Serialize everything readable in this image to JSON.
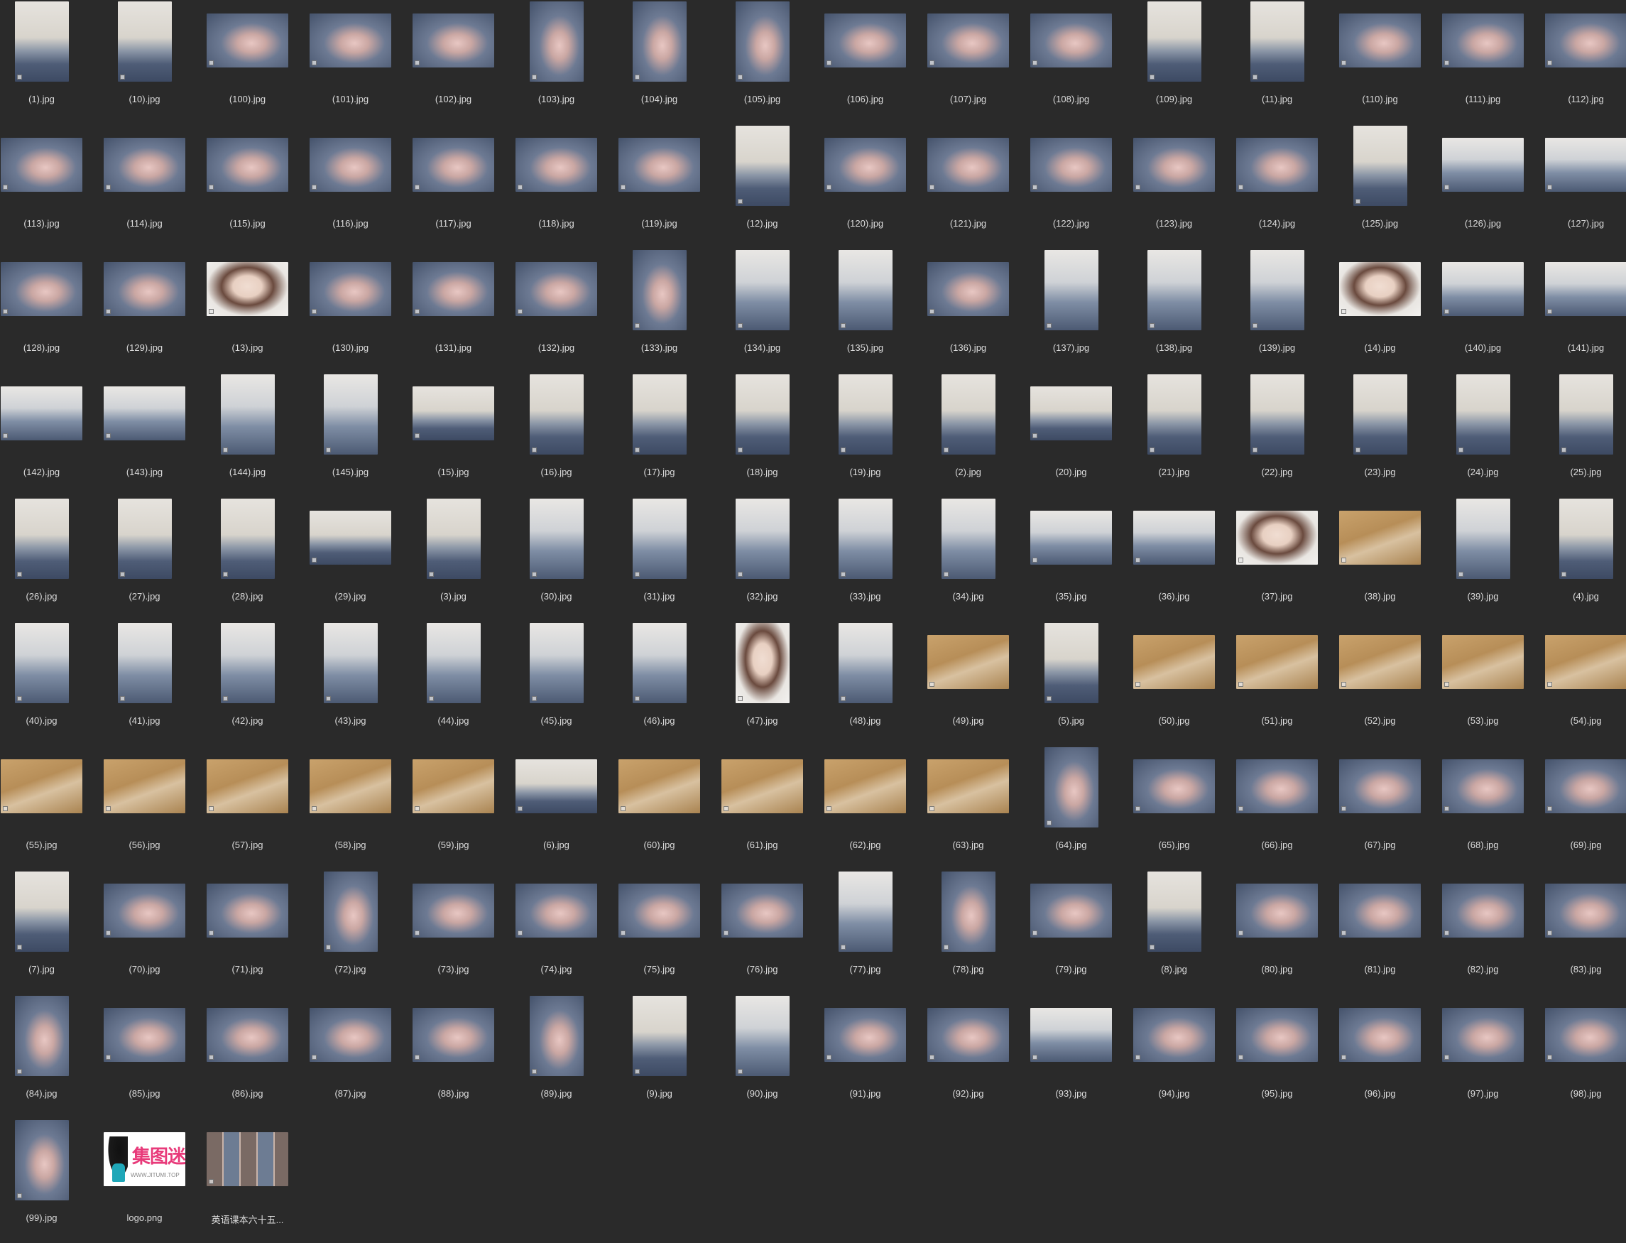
{
  "window": {
    "background": "#2a2a2a"
  },
  "logo": {
    "text": "集图迷",
    "url": "WWW.JITUMI.TOP"
  },
  "files": [
    {
      "name": "(1).jpg",
      "kind": "portrait",
      "style": "room"
    },
    {
      "name": "(10).jpg",
      "kind": "portrait",
      "style": "room"
    },
    {
      "name": "(100).jpg",
      "kind": "land",
      "style": "bed"
    },
    {
      "name": "(101).jpg",
      "kind": "land",
      "style": "bed"
    },
    {
      "name": "(102).jpg",
      "kind": "land",
      "style": "bed"
    },
    {
      "name": "(103).jpg",
      "kind": "portrait",
      "style": "bed"
    },
    {
      "name": "(104).jpg",
      "kind": "portrait",
      "style": "bed"
    },
    {
      "name": "(105).jpg",
      "kind": "portrait",
      "style": "bed"
    },
    {
      "name": "(106).jpg",
      "kind": "land",
      "style": "bed"
    },
    {
      "name": "(107).jpg",
      "kind": "land",
      "style": "bed"
    },
    {
      "name": "(108).jpg",
      "kind": "land",
      "style": "bed"
    },
    {
      "name": "(109).jpg",
      "kind": "portrait",
      "style": "room"
    },
    {
      "name": "(11).jpg",
      "kind": "portrait",
      "style": "room"
    },
    {
      "name": "(110).jpg",
      "kind": "land",
      "style": "bed"
    },
    {
      "name": "(111).jpg",
      "kind": "land",
      "style": "bed"
    },
    {
      "name": "(112).jpg",
      "kind": "land",
      "style": "bed"
    },
    {
      "name": "(113).jpg",
      "kind": "land",
      "style": "bed"
    },
    {
      "name": "(114).jpg",
      "kind": "land",
      "style": "bed"
    },
    {
      "name": "(115).jpg",
      "kind": "land",
      "style": "bed"
    },
    {
      "name": "(116).jpg",
      "kind": "land",
      "style": "bed"
    },
    {
      "name": "(117).jpg",
      "kind": "land",
      "style": "bed"
    },
    {
      "name": "(118).jpg",
      "kind": "land",
      "style": "bed"
    },
    {
      "name": "(119).jpg",
      "kind": "land",
      "style": "bed"
    },
    {
      "name": "(12).jpg",
      "kind": "portrait",
      "style": "room"
    },
    {
      "name": "(120).jpg",
      "kind": "land",
      "style": "bed"
    },
    {
      "name": "(121).jpg",
      "kind": "land",
      "style": "bed"
    },
    {
      "name": "(122).jpg",
      "kind": "land",
      "style": "bed"
    },
    {
      "name": "(123).jpg",
      "kind": "land",
      "style": "bed"
    },
    {
      "name": "(124).jpg",
      "kind": "land",
      "style": "bed"
    },
    {
      "name": "(125).jpg",
      "kind": "portrait",
      "style": "room"
    },
    {
      "name": "(126).jpg",
      "kind": "land",
      "style": "sofa"
    },
    {
      "name": "(127).jpg",
      "kind": "land",
      "style": "sofa"
    },
    {
      "name": "(128).jpg",
      "kind": "land",
      "style": "bed"
    },
    {
      "name": "(129).jpg",
      "kind": "land",
      "style": "bed"
    },
    {
      "name": "(13).jpg",
      "kind": "land",
      "style": "face"
    },
    {
      "name": "(130).jpg",
      "kind": "land",
      "style": "bed"
    },
    {
      "name": "(131).jpg",
      "kind": "land",
      "style": "bed"
    },
    {
      "name": "(132).jpg",
      "kind": "land",
      "style": "bed"
    },
    {
      "name": "(133).jpg",
      "kind": "portrait",
      "style": "bed"
    },
    {
      "name": "(134).jpg",
      "kind": "portrait",
      "style": "sofa"
    },
    {
      "name": "(135).jpg",
      "kind": "portrait",
      "style": "sofa"
    },
    {
      "name": "(136).jpg",
      "kind": "land",
      "style": "bed"
    },
    {
      "name": "(137).jpg",
      "kind": "portrait",
      "style": "sofa"
    },
    {
      "name": "(138).jpg",
      "kind": "portrait",
      "style": "sofa"
    },
    {
      "name": "(139).jpg",
      "kind": "portrait",
      "style": "sofa"
    },
    {
      "name": "(14).jpg",
      "kind": "land",
      "style": "face"
    },
    {
      "name": "(140).jpg",
      "kind": "land",
      "style": "sofa"
    },
    {
      "name": "(141).jpg",
      "kind": "land",
      "style": "sofa"
    },
    {
      "name": "(142).jpg",
      "kind": "land",
      "style": "sofa"
    },
    {
      "name": "(143).jpg",
      "kind": "land",
      "style": "sofa"
    },
    {
      "name": "(144).jpg",
      "kind": "portrait",
      "style": "sofa"
    },
    {
      "name": "(145).jpg",
      "kind": "portrait",
      "style": "sofa"
    },
    {
      "name": "(15).jpg",
      "kind": "land",
      "style": "room"
    },
    {
      "name": "(16).jpg",
      "kind": "portrait",
      "style": "room"
    },
    {
      "name": "(17).jpg",
      "kind": "portrait",
      "style": "room"
    },
    {
      "name": "(18).jpg",
      "kind": "portrait",
      "style": "room"
    },
    {
      "name": "(19).jpg",
      "kind": "portrait",
      "style": "room"
    },
    {
      "name": "(2).jpg",
      "kind": "portrait",
      "style": "room"
    },
    {
      "name": "(20).jpg",
      "kind": "land",
      "style": "room"
    },
    {
      "name": "(21).jpg",
      "kind": "portrait",
      "style": "room"
    },
    {
      "name": "(22).jpg",
      "kind": "portrait",
      "style": "room"
    },
    {
      "name": "(23).jpg",
      "kind": "portrait",
      "style": "room"
    },
    {
      "name": "(24).jpg",
      "kind": "portrait",
      "style": "room"
    },
    {
      "name": "(25).jpg",
      "kind": "portrait",
      "style": "room"
    },
    {
      "name": "(26).jpg",
      "kind": "portrait",
      "style": "room"
    },
    {
      "name": "(27).jpg",
      "kind": "portrait",
      "style": "room"
    },
    {
      "name": "(28).jpg",
      "kind": "portrait",
      "style": "room"
    },
    {
      "name": "(29).jpg",
      "kind": "land",
      "style": "room"
    },
    {
      "name": "(3).jpg",
      "kind": "portrait",
      "style": "room"
    },
    {
      "name": "(30).jpg",
      "kind": "portrait",
      "style": "sofa"
    },
    {
      "name": "(31).jpg",
      "kind": "portrait",
      "style": "sofa"
    },
    {
      "name": "(32).jpg",
      "kind": "portrait",
      "style": "sofa"
    },
    {
      "name": "(33).jpg",
      "kind": "portrait",
      "style": "sofa"
    },
    {
      "name": "(34).jpg",
      "kind": "portrait",
      "style": "sofa"
    },
    {
      "name": "(35).jpg",
      "kind": "land",
      "style": "sofa"
    },
    {
      "name": "(36).jpg",
      "kind": "land",
      "style": "sofa"
    },
    {
      "name": "(37).jpg",
      "kind": "land",
      "style": "face"
    },
    {
      "name": "(38).jpg",
      "kind": "land",
      "style": "floor"
    },
    {
      "name": "(39).jpg",
      "kind": "portrait",
      "style": "sofa"
    },
    {
      "name": "(4).jpg",
      "kind": "portrait",
      "style": "room"
    },
    {
      "name": "(40).jpg",
      "kind": "portrait",
      "style": "sofa"
    },
    {
      "name": "(41).jpg",
      "kind": "portrait",
      "style": "sofa"
    },
    {
      "name": "(42).jpg",
      "kind": "portrait",
      "style": "sofa"
    },
    {
      "name": "(43).jpg",
      "kind": "portrait",
      "style": "sofa"
    },
    {
      "name": "(44).jpg",
      "kind": "portrait",
      "style": "sofa"
    },
    {
      "name": "(45).jpg",
      "kind": "portrait",
      "style": "sofa"
    },
    {
      "name": "(46).jpg",
      "kind": "portrait",
      "style": "sofa"
    },
    {
      "name": "(47).jpg",
      "kind": "portrait",
      "style": "face"
    },
    {
      "name": "(48).jpg",
      "kind": "portrait",
      "style": "sofa"
    },
    {
      "name": "(49).jpg",
      "kind": "land",
      "style": "floor"
    },
    {
      "name": "(5).jpg",
      "kind": "portrait",
      "style": "room"
    },
    {
      "name": "(50).jpg",
      "kind": "land",
      "style": "floor"
    },
    {
      "name": "(51).jpg",
      "kind": "land",
      "style": "floor"
    },
    {
      "name": "(52).jpg",
      "kind": "land",
      "style": "floor"
    },
    {
      "name": "(53).jpg",
      "kind": "land",
      "style": "floor"
    },
    {
      "name": "(54).jpg",
      "kind": "land",
      "style": "floor"
    },
    {
      "name": "(55).jpg",
      "kind": "land",
      "style": "floor"
    },
    {
      "name": "(56).jpg",
      "kind": "land",
      "style": "floor"
    },
    {
      "name": "(57).jpg",
      "kind": "land",
      "style": "floor"
    },
    {
      "name": "(58).jpg",
      "kind": "land",
      "style": "floor"
    },
    {
      "name": "(59).jpg",
      "kind": "land",
      "style": "floor"
    },
    {
      "name": "(6).jpg",
      "kind": "land",
      "style": "room"
    },
    {
      "name": "(60).jpg",
      "kind": "land",
      "style": "floor"
    },
    {
      "name": "(61).jpg",
      "kind": "land",
      "style": "floor"
    },
    {
      "name": "(62).jpg",
      "kind": "land",
      "style": "floor"
    },
    {
      "name": "(63).jpg",
      "kind": "land",
      "style": "floor"
    },
    {
      "name": "(64).jpg",
      "kind": "portrait",
      "style": "bed"
    },
    {
      "name": "(65).jpg",
      "kind": "land",
      "style": "bed"
    },
    {
      "name": "(66).jpg",
      "kind": "land",
      "style": "bed"
    },
    {
      "name": "(67).jpg",
      "kind": "land",
      "style": "bed"
    },
    {
      "name": "(68).jpg",
      "kind": "land",
      "style": "bed"
    },
    {
      "name": "(69).jpg",
      "kind": "land",
      "style": "bed"
    },
    {
      "name": "(7).jpg",
      "kind": "portrait",
      "style": "room"
    },
    {
      "name": "(70).jpg",
      "kind": "land",
      "style": "bed"
    },
    {
      "name": "(71).jpg",
      "kind": "land",
      "style": "bed"
    },
    {
      "name": "(72).jpg",
      "kind": "portrait",
      "style": "bed"
    },
    {
      "name": "(73).jpg",
      "kind": "land",
      "style": "bed"
    },
    {
      "name": "(74).jpg",
      "kind": "land",
      "style": "bed"
    },
    {
      "name": "(75).jpg",
      "kind": "land",
      "style": "bed"
    },
    {
      "name": "(76).jpg",
      "kind": "land",
      "style": "bed"
    },
    {
      "name": "(77).jpg",
      "kind": "portrait",
      "style": "sofa"
    },
    {
      "name": "(78).jpg",
      "kind": "portrait",
      "style": "bed"
    },
    {
      "name": "(79).jpg",
      "kind": "land",
      "style": "bed"
    },
    {
      "name": "(8).jpg",
      "kind": "portrait",
      "style": "room"
    },
    {
      "name": "(80).jpg",
      "kind": "land",
      "style": "bed"
    },
    {
      "name": "(81).jpg",
      "kind": "land",
      "style": "bed"
    },
    {
      "name": "(82).jpg",
      "kind": "land",
      "style": "bed"
    },
    {
      "name": "(83).jpg",
      "kind": "land",
      "style": "bed"
    },
    {
      "name": "(84).jpg",
      "kind": "portrait",
      "style": "bed"
    },
    {
      "name": "(85).jpg",
      "kind": "land",
      "style": "bed"
    },
    {
      "name": "(86).jpg",
      "kind": "land",
      "style": "bed"
    },
    {
      "name": "(87).jpg",
      "kind": "land",
      "style": "bed"
    },
    {
      "name": "(88).jpg",
      "kind": "land",
      "style": "bed"
    },
    {
      "name": "(89).jpg",
      "kind": "portrait",
      "style": "bed"
    },
    {
      "name": "(9).jpg",
      "kind": "portrait",
      "style": "room"
    },
    {
      "name": "(90).jpg",
      "kind": "portrait",
      "style": "sofa"
    },
    {
      "name": "(91).jpg",
      "kind": "land",
      "style": "bed"
    },
    {
      "name": "(92).jpg",
      "kind": "land",
      "style": "bed"
    },
    {
      "name": "(93).jpg",
      "kind": "land",
      "style": "sofa"
    },
    {
      "name": "(94).jpg",
      "kind": "land",
      "style": "bed"
    },
    {
      "name": "(95).jpg",
      "kind": "land",
      "style": "bed"
    },
    {
      "name": "(96).jpg",
      "kind": "land",
      "style": "bed"
    },
    {
      "name": "(97).jpg",
      "kind": "land",
      "style": "bed"
    },
    {
      "name": "(98).jpg",
      "kind": "land",
      "style": "bed"
    },
    {
      "name": "(99).jpg",
      "kind": "portrait",
      "style": "bed"
    },
    {
      "name": "logo.png",
      "kind": "logo",
      "style": "logo"
    },
    {
      "name": "英语课本六十五...",
      "kind": "land",
      "style": "collage"
    }
  ]
}
